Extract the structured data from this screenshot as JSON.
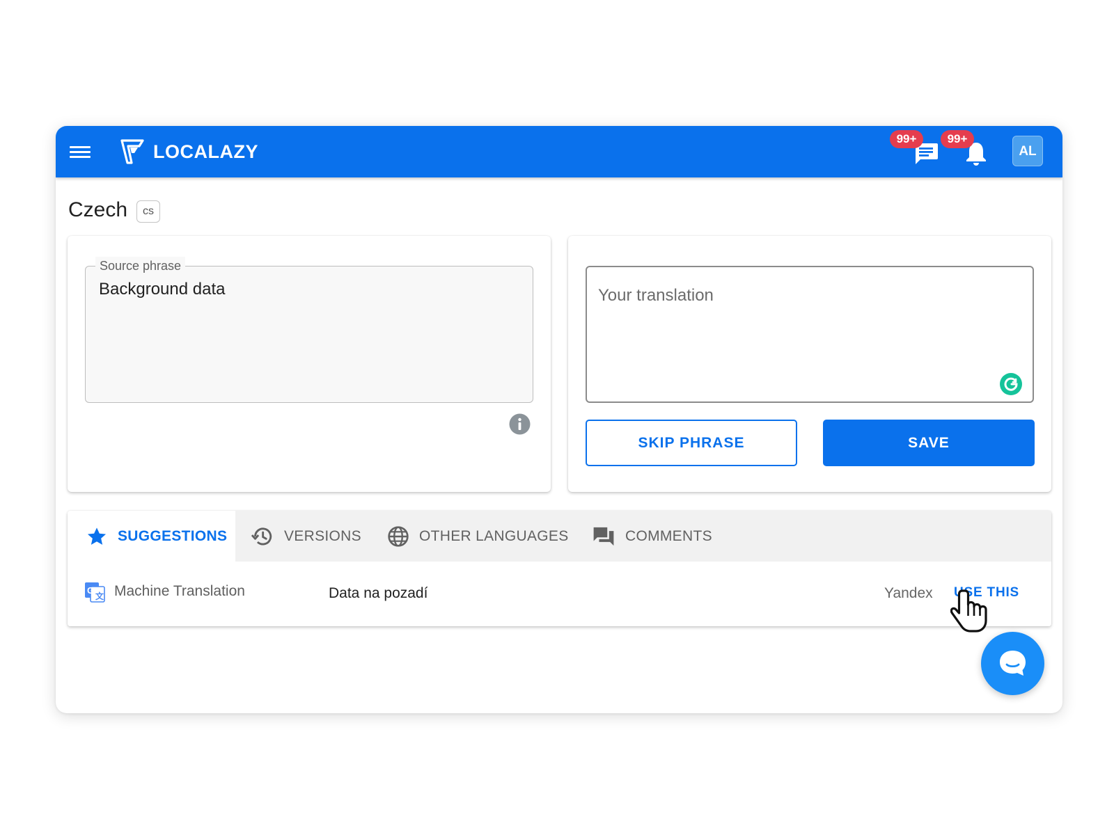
{
  "header": {
    "brand_name": "LOCALAZY",
    "messages_badge": "99+",
    "notifications_badge": "99+",
    "avatar_initials": "AL",
    "brand_color": "#0a71ec"
  },
  "language": {
    "name": "Czech",
    "code": "cs"
  },
  "source": {
    "legend": "Source phrase",
    "text": "Background data"
  },
  "translation": {
    "placeholder": "Your translation",
    "value": ""
  },
  "actions": {
    "skip_label": "SKIP PHRASE",
    "save_label": "SAVE"
  },
  "tabs": [
    {
      "label": "SUGGESTIONS",
      "icon": "star-icon",
      "active": true
    },
    {
      "label": "VERSIONS",
      "icon": "history-icon",
      "active": false
    },
    {
      "label": "OTHER LANGUAGES",
      "icon": "globe-icon",
      "active": false
    },
    {
      "label": "COMMENTS",
      "icon": "comments-icon",
      "active": false
    }
  ],
  "suggestions": [
    {
      "type": "Machine Translation",
      "icon": "google-translate-icon",
      "text": "Data na pozadí",
      "provider": "Yandex",
      "action": "USE THIS"
    }
  ],
  "icons": {
    "menu": "hamburger-menu-icon",
    "messages": "chat-message-icon",
    "notifications": "bell-icon",
    "info": "info-icon",
    "grammarly": "grammarly-icon",
    "chat_fab": "chat-bubble-icon",
    "cursor": "hand-pointer-icon"
  }
}
